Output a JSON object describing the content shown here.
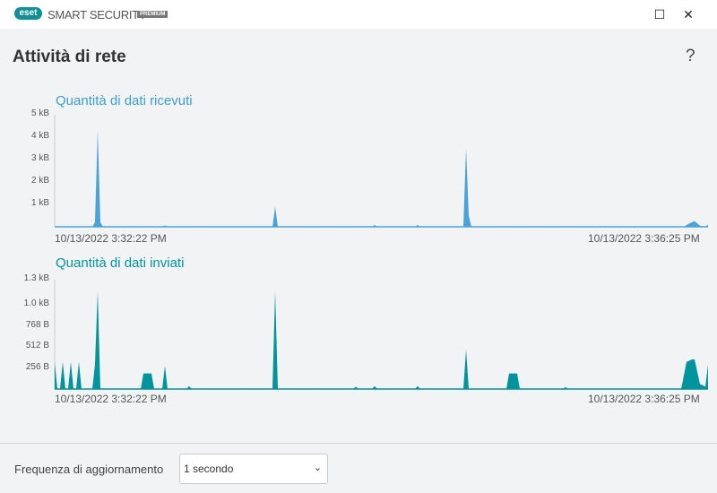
{
  "app": {
    "logo": "eset",
    "brand": "SMART SECURITY",
    "edition": "PREMIUM"
  },
  "window": {
    "minimize": "–",
    "maximize": "☐",
    "close": "✕"
  },
  "page": {
    "title": "Attività di rete",
    "help": "?"
  },
  "colors": {
    "received": "#4aa3d8",
    "sent": "#00959c"
  },
  "chart_data": [
    {
      "type": "area",
      "title": "Quantità di dati ricevuti",
      "unit": "kB",
      "ylim": [
        0,
        5
      ],
      "ticks": [
        "5 kB",
        "4 kB",
        "3 kB",
        "2 kB",
        "1 kB"
      ],
      "tick_values": [
        5,
        4,
        3,
        2,
        1
      ],
      "x_start": "10/13/2022 3:32:22 PM",
      "x_end": "10/13/2022 3:36:25 PM",
      "xlim": [
        0,
        243
      ],
      "points": [
        [
          0,
          0
        ],
        [
          14,
          0
        ],
        [
          15,
          0.2
        ],
        [
          16,
          4.3
        ],
        [
          17,
          0.2
        ],
        [
          18,
          0
        ],
        [
          40,
          0
        ],
        [
          41,
          0.06
        ],
        [
          42,
          0
        ],
        [
          81,
          0
        ],
        [
          82,
          0.9
        ],
        [
          83,
          0
        ],
        [
          118,
          0
        ],
        [
          119,
          0.08
        ],
        [
          120,
          0
        ],
        [
          134,
          0
        ],
        [
          135,
          0.08
        ],
        [
          136,
          0
        ],
        [
          152,
          0
        ],
        [
          153,
          3.5
        ],
        [
          154,
          0.5
        ],
        [
          155,
          0
        ],
        [
          234,
          0
        ],
        [
          236,
          0.15
        ],
        [
          238,
          0.25
        ],
        [
          240,
          0.05
        ],
        [
          242,
          0
        ],
        [
          243,
          0.1
        ]
      ]
    },
    {
      "type": "area",
      "title": "Quantità di dati inviati",
      "unit": "B",
      "ylim": [
        0,
        1331
      ],
      "ticks": [
        "1.3 kB",
        "1.0 kB",
        "768 B",
        "512 B",
        "256 B"
      ],
      "tick_values": [
        1331,
        1024,
        768,
        512,
        256
      ],
      "x_start": "10/13/2022 3:32:22 PM",
      "x_end": "10/13/2022 3:36:25 PM",
      "xlim": [
        0,
        243
      ],
      "points": [
        [
          0,
          330
        ],
        [
          1,
          0
        ],
        [
          2,
          0
        ],
        [
          3,
          330
        ],
        [
          4,
          0
        ],
        [
          5,
          0
        ],
        [
          6,
          330
        ],
        [
          7,
          0
        ],
        [
          8,
          0
        ],
        [
          9,
          330
        ],
        [
          10,
          0
        ],
        [
          14,
          0
        ],
        [
          15,
          300
        ],
        [
          16,
          1190
        ],
        [
          17,
          0
        ],
        [
          32,
          0
        ],
        [
          33,
          190
        ],
        [
          36,
          190
        ],
        [
          37,
          0
        ],
        [
          40,
          0
        ],
        [
          41,
          280
        ],
        [
          42,
          0
        ],
        [
          49,
          0
        ],
        [
          50,
          35
        ],
        [
          51,
          0
        ],
        [
          81,
          0
        ],
        [
          82,
          1190
        ],
        [
          83,
          0
        ],
        [
          111,
          0
        ],
        [
          112,
          30
        ],
        [
          113,
          0
        ],
        [
          118,
          0
        ],
        [
          119,
          35
        ],
        [
          120,
          0
        ],
        [
          134,
          0
        ],
        [
          135,
          35
        ],
        [
          136,
          0
        ],
        [
          152,
          0
        ],
        [
          153,
          480
        ],
        [
          154,
          0
        ],
        [
          168,
          0
        ],
        [
          169,
          190
        ],
        [
          172,
          190
        ],
        [
          173,
          0
        ],
        [
          189,
          0
        ],
        [
          190,
          25
        ],
        [
          191,
          0
        ],
        [
          233,
          0
        ],
        [
          235,
          330
        ],
        [
          237,
          360
        ],
        [
          238,
          360
        ],
        [
          240,
          60
        ],
        [
          242,
          30
        ],
        [
          243,
          300
        ]
      ]
    }
  ],
  "footer": {
    "label": "Frequenza di aggiornamento",
    "value": "1 secondo",
    "chevron": "⌄"
  }
}
